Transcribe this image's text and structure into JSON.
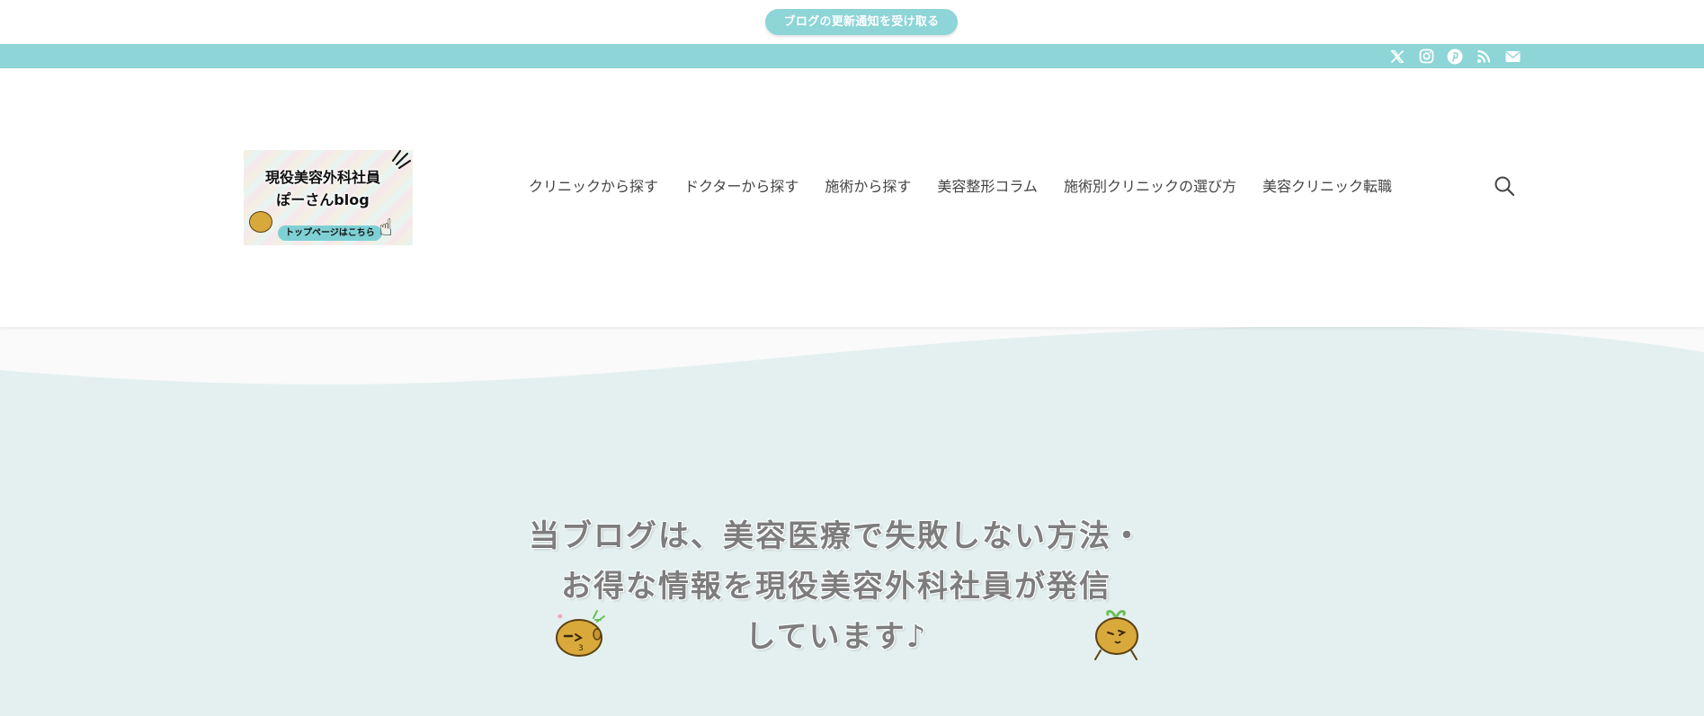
{
  "notification": {
    "button_label": "ブログの更新通知を受け取る"
  },
  "social": {
    "icons": [
      "x-icon",
      "instagram-icon",
      "pinterest-icon",
      "rss-icon",
      "mail-icon"
    ]
  },
  "header": {
    "logo": {
      "title_line1": "現役美容外科社員",
      "title_line2": "ぽーさんblog",
      "pill": "トップページはこちら"
    },
    "nav": [
      "クリニックから探す",
      "ドクターから探す",
      "施術から探す",
      "美容整形コラム",
      "施術別クリニックの選び方",
      "美容クリニック転職"
    ]
  },
  "hero": {
    "line1": "当ブログは、美容医療で失敗しない方法・",
    "line2": "お得な情報を現役美容外科社員が発信",
    "line3": "しています♪"
  },
  "colors": {
    "accent": "#8dd5d7",
    "hero_bg": "#e4f0f0",
    "nav_text": "#444444",
    "hero_text": "#7d7d7d"
  }
}
